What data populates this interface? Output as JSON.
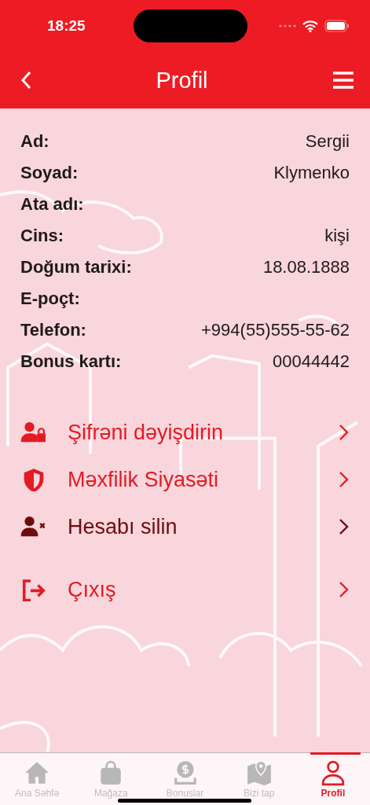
{
  "status_bar": {
    "time": "18:25"
  },
  "header": {
    "title": "Profil"
  },
  "fields": [
    {
      "label": "Ad:",
      "value": "Sergii"
    },
    {
      "label": "Soyad:",
      "value": "Klymenko"
    },
    {
      "label": "Ata adı:"
    },
    {
      "label": "Cins:",
      "value": "kişi"
    },
    {
      "label": "Doğum tarixi:",
      "value": "18.08.1888"
    },
    {
      "label": "E-poçt:"
    },
    {
      "label": "Telefon:",
      "value": "+994(55)555-55-62"
    },
    {
      "label": "Bonus kartı:",
      "value": "00044442"
    }
  ],
  "menu": [
    {
      "label": "Şifrəni dəyişdirin",
      "color": "#e31b23"
    },
    {
      "label": "Məxfilik Siyasəti",
      "color": "#e31b23"
    },
    {
      "label": "Hesabı silin",
      "color": "#6b0d0d"
    },
    {
      "label": "Çıxış",
      "color": "#e31b23"
    }
  ],
  "tabs": [
    {
      "label": "Ana Səhfə",
      "selected": false
    },
    {
      "label": "Mağaza",
      "selected": false
    },
    {
      "label": "Bonuslar",
      "selected": false
    },
    {
      "label": "Bizi tap",
      "selected": false
    },
    {
      "label": "Profil",
      "selected": true
    }
  ]
}
